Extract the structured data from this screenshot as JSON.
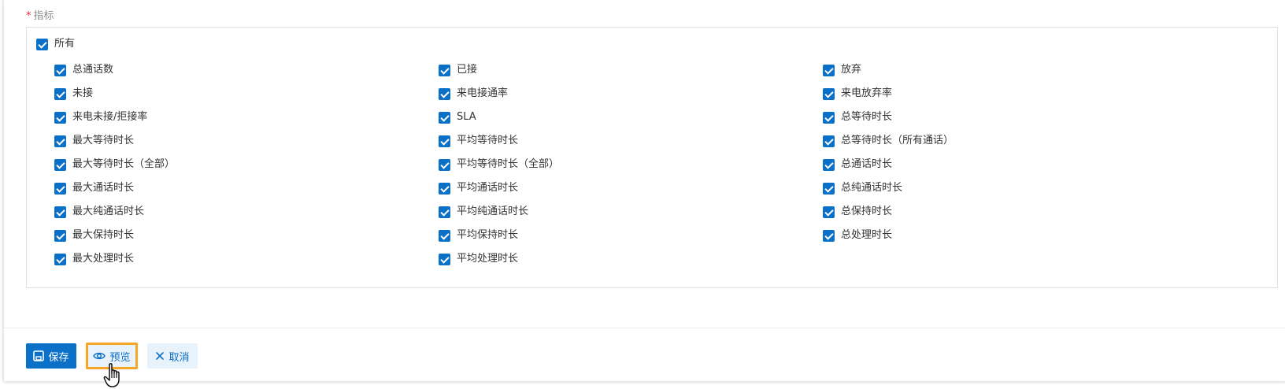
{
  "form": {
    "field_label": "指标",
    "required_mark": "*"
  },
  "metrics": {
    "all_label": "所有",
    "columns": [
      [
        "总通话数",
        "未接",
        "来电未接/拒接率",
        "最大等待时长",
        "最大等待时长（全部）",
        "最大通话时长",
        "最大纯通话时长",
        "最大保持时长",
        "最大处理时长"
      ],
      [
        "已接",
        "来电接通率",
        "SLA",
        "平均等待时长",
        "平均等待时长（全部）",
        "平均通话时长",
        "平均纯通话时长",
        "平均保持时长",
        "平均处理时长"
      ],
      [
        "放弃",
        "来电放弃率",
        "总等待时长",
        "总等待时长（所有通话）",
        "总通话时长",
        "总纯通话时长",
        "总保持时长",
        "总处理时长"
      ]
    ]
  },
  "footer": {
    "save_label": "保存",
    "preview_label": "预览",
    "cancel_label": "取消"
  },
  "colors": {
    "accent": "#0a70c8",
    "highlight": "#f5a623",
    "required": "#f5222d"
  },
  "icons": {
    "save": "save-icon",
    "preview": "eye-icon",
    "cancel": "close-icon",
    "cursor": "hand-pointer-icon"
  }
}
